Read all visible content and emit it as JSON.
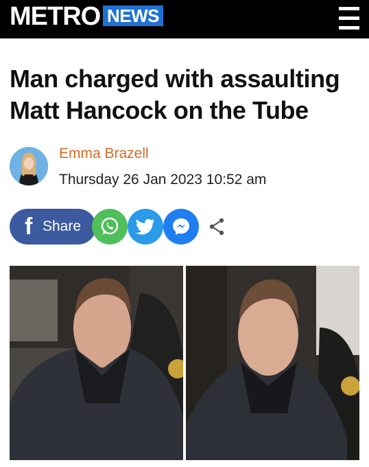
{
  "header": {
    "logo": "METRO",
    "section": "NEWS",
    "menu_icon": "hamburger-menu-icon"
  },
  "article": {
    "headline": "Man charged with assaulting Matt Hancock on the Tube",
    "author": "Emma Brazell",
    "date": "Thursday 26 Jan 2023 10:52 am"
  },
  "share": {
    "facebook_label": "Share",
    "icons": [
      "facebook-icon",
      "whatsapp-icon",
      "twitter-icon",
      "messenger-icon",
      "share-icon"
    ]
  },
  "colors": {
    "header_bg": "#000000",
    "section_badge": "#1f72d4",
    "author": "#d06b26",
    "facebook": "#3b5aa0",
    "whatsapp": "#4fbe5b",
    "twitter": "#2a9ae9",
    "messenger": "#1f7ef0"
  }
}
